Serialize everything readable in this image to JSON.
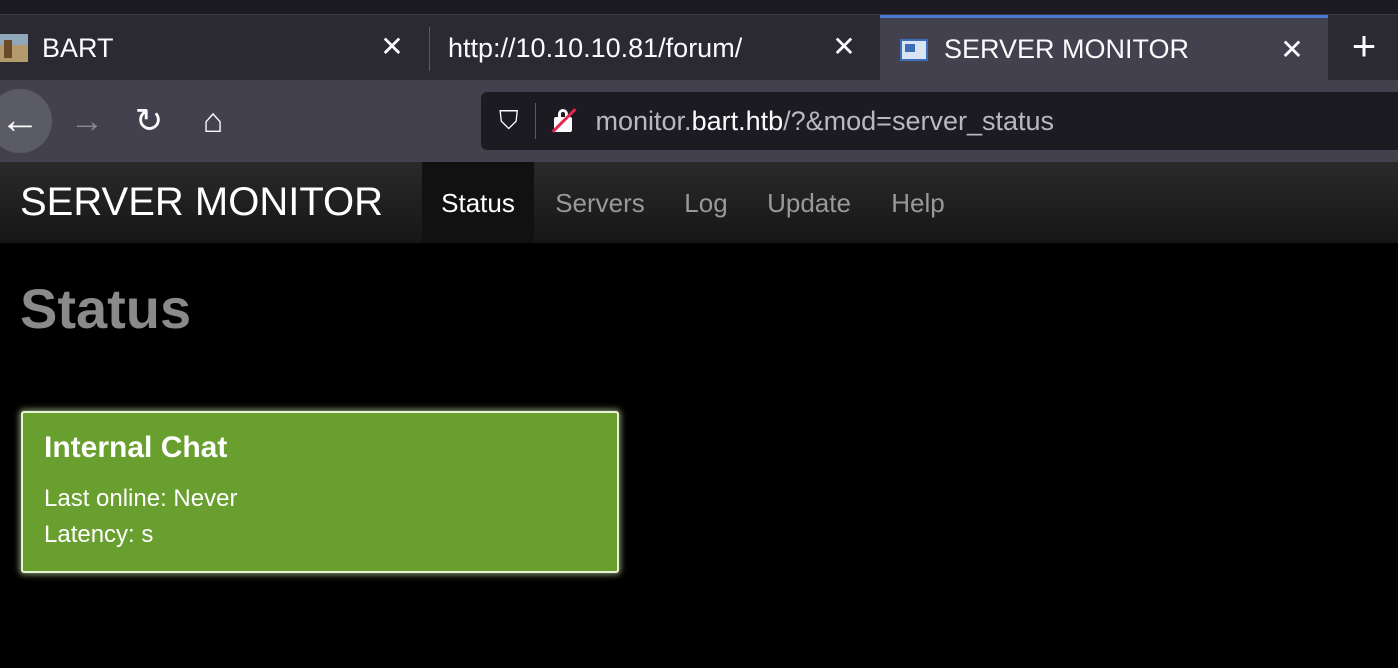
{
  "browser": {
    "tabs": [
      {
        "title": "BART",
        "icon": "bart-favicon-icon",
        "active": false
      },
      {
        "title": "http://10.10.10.81/forum/",
        "icon": "",
        "active": false
      },
      {
        "title": "SERVER MONITOR",
        "icon": "server-monitor-favicon-icon",
        "active": true
      }
    ],
    "close_glyph": "✕",
    "new_tab_glyph": "+",
    "url": {
      "prefix": "monitor.",
      "domain": "bart.htb",
      "suffix": "/?&mod=server_status"
    }
  },
  "app": {
    "brand": "SERVER MONITOR",
    "nav": [
      {
        "label": "Status",
        "active": true
      },
      {
        "label": "Servers",
        "active": false
      },
      {
        "label": "Log",
        "active": false
      },
      {
        "label": "Update",
        "active": false
      },
      {
        "label": "Help",
        "active": false
      }
    ],
    "page_title": "Status",
    "servers": [
      {
        "name": "Internal Chat",
        "last_online": "Last online: Never",
        "latency": "Latency: s",
        "status_color": "#689f2e"
      }
    ]
  }
}
